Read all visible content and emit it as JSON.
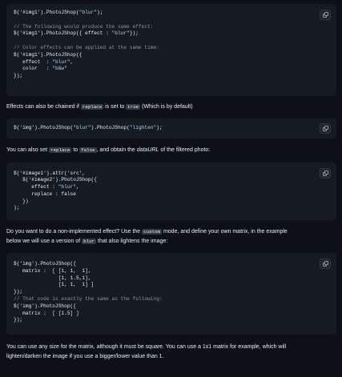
{
  "copy_icon": "copy-icon",
  "block1": [
    [
      [
        "pl",
        "$('#img1').PhotoJShop("
      ],
      [
        "str",
        "\"blur\""
      ],
      [
        "pl",
        ");"
      ]
    ],
    [],
    [
      [
        "cm",
        "// The following would produce the same effect:"
      ]
    ],
    [
      [
        "pl",
        "$('#img1').PhotoJShop({ effect : "
      ],
      [
        "str",
        "\"blur\""
      ],
      [
        "pl",
        "});"
      ]
    ],
    [],
    [
      [
        "cm",
        "// Color effects can be applied at the same time:"
      ]
    ],
    [
      [
        "pl",
        "$('#img1').PhotoJShop({"
      ]
    ],
    [
      [
        "pl",
        "   effect  : "
      ],
      [
        "str",
        "\"blur\""
      ],
      [
        "pl",
        ","
      ]
    ],
    [
      [
        "pl",
        "   color   : "
      ],
      [
        "str",
        "\"b&w\""
      ]
    ],
    [
      [
        "pl",
        "});"
      ]
    ]
  ],
  "para1": {
    "a": "Effects can also be chained if ",
    "code1": "replace",
    "b": " is set to ",
    "code2": "true",
    "c": " (Which is by default)"
  },
  "block2": [
    [
      [
        "pl",
        "$('img').PhotoJShop("
      ],
      [
        "str",
        "\"blur\""
      ],
      [
        "pl",
        ").PhotoJShop("
      ],
      [
        "str",
        "\"lighten\""
      ],
      [
        "pl",
        ");"
      ]
    ]
  ],
  "para2": {
    "a": "You can also set ",
    "code1": "replace",
    "b": " to ",
    "code2": "false",
    "c": ", and obtain the ",
    "em": "dataURL",
    "d": " of the filtered photo:"
  },
  "block3": [
    [
      [
        "pl",
        "$('#image1').attr('src',"
      ]
    ],
    [
      [
        "pl",
        "   $('#image2').PhotoJShop({"
      ]
    ],
    [
      [
        "pl",
        "      effect : "
      ],
      [
        "str",
        "\"blur\""
      ],
      [
        "pl",
        ","
      ]
    ],
    [
      [
        "pl",
        "      replace : false"
      ]
    ],
    [
      [
        "pl",
        "   })"
      ]
    ],
    [
      [
        "pl",
        ");"
      ]
    ]
  ],
  "para3": {
    "a": "Do you want to do a non-implemented effect? Use the ",
    "code1": "custom",
    "b": " mode, and define your own matrix, in the example",
    "c": "below we will use a version of ",
    "code2": "blur",
    "d": " that also lightens the image:"
  },
  "block4": [
    [
      [
        "pl",
        "$('img').PhotoJShop({"
      ]
    ],
    [
      [
        "pl",
        "   matrix :  [ [1, 1,  1],"
      ]
    ],
    [
      [
        "pl",
        "               [1, 1.5,1],"
      ]
    ],
    [
      [
        "pl",
        "               [1, 1,  1] ]"
      ]
    ],
    [
      [
        "pl",
        "});"
      ]
    ],
    [
      [
        "cm",
        "// That code is exactly the same as the following:"
      ]
    ],
    [
      [
        "pl",
        "$('img').PhotoJShop({"
      ]
    ],
    [
      [
        "pl",
        "   matrix :  [ [1.5] ]"
      ]
    ],
    [
      [
        "pl",
        "});"
      ]
    ]
  ],
  "para4": {
    "line1": "You can use any size for the matrix, although it must be square. You can use a 1x1 matrix for example, which will",
    "line2": "lighten/darken the image if you use a bigger/lower value than 1."
  }
}
